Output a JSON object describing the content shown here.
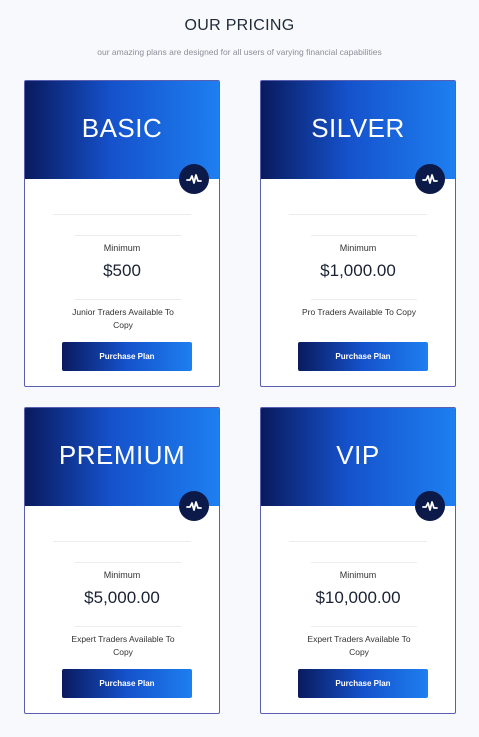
{
  "header": {
    "title": "OUR PRICING",
    "subtitle": "our amazing plans are designed for all users of varying financial capabilities"
  },
  "plans": [
    {
      "name": "BASIC",
      "min_label": "Minimum",
      "price": "$500",
      "description": "Junior Traders Available To Copy",
      "button": "Purchase Plan"
    },
    {
      "name": "SILVER",
      "min_label": "Minimum",
      "price": "$1,000.00",
      "description": "Pro Traders Available To Copy",
      "button": "Purchase Plan"
    },
    {
      "name": "PREMIUM",
      "min_label": "Minimum",
      "price": "$5,000.00",
      "description": "Expert Traders Available To Copy",
      "button": "Purchase Plan"
    },
    {
      "name": "VIP",
      "min_label": "Minimum",
      "price": "$10,000.00",
      "description": "Expert Traders Available To Copy",
      "button": "Purchase Plan"
    }
  ],
  "icons": {
    "badge": "activity-pulse-icon"
  },
  "colors": {
    "header_dark": "#0a1a5e",
    "header_light": "#1e7ff0",
    "badge": "#0c1a4a",
    "border": "#5a5fb0"
  }
}
